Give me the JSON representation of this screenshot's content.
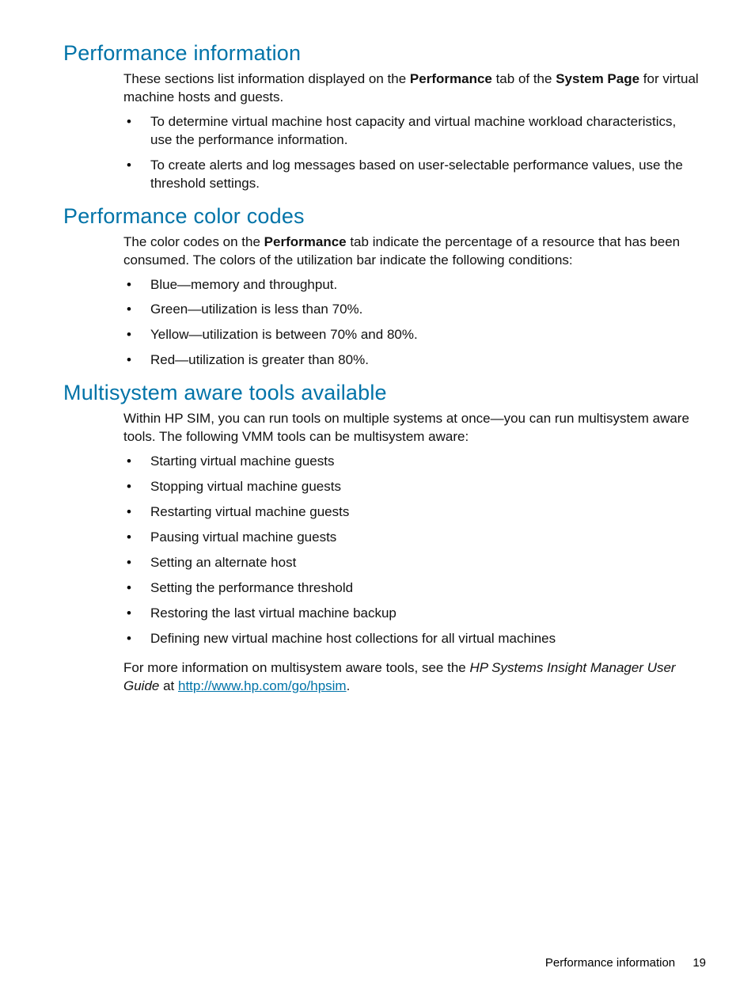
{
  "sections": [
    {
      "heading": "Performance information",
      "intro": {
        "pre": "These sections list information displayed on the ",
        "bold1": "Performance",
        "mid": " tab of the ",
        "bold2": "System Page",
        "post": " for virtual machine hosts and guests."
      },
      "bullets": [
        "To determine virtual machine host capacity and virtual machine workload characteristics, use the performance information.",
        "To create alerts and log messages based on user-selectable performance values, use the threshold settings."
      ]
    },
    {
      "heading": "Performance color codes",
      "intro2": {
        "pre": "The color codes on the ",
        "bold1": "Performance",
        "post": " tab indicate the percentage of a resource that has been consumed. The colors of the utilization bar indicate the following conditions:"
      },
      "bullets": [
        "Blue—memory and throughput.",
        "Green—utilization is less than 70%.",
        "Yellow—utilization is between 70% and 80%.",
        "Red—utilization is greater than 80%."
      ]
    },
    {
      "heading": "Multisystem aware tools available",
      "para": "Within HP SIM, you can run tools on multiple systems at once—you can run multisystem aware tools. The following VMM tools can be multisystem aware:",
      "bullets": [
        "Starting virtual machine guests",
        "Stopping virtual machine guests",
        "Restarting virtual machine guests",
        "Pausing virtual machine guests",
        "Setting an alternate host",
        "Setting the performance threshold",
        "Restoring the last virtual machine backup",
        "Defining new virtual machine host collections for all virtual machines"
      ],
      "closing": {
        "pre": "For more information on multisystem aware tools, see the ",
        "italic": "HP Systems Insight Manager User Guide",
        "mid": " at ",
        "link_text": "http://www.hp.com/go/hpsim",
        "link_href": "http://www.hp.com/go/hpsim",
        "post": "."
      }
    }
  ],
  "footer": {
    "label": "Performance information",
    "page": "19"
  }
}
